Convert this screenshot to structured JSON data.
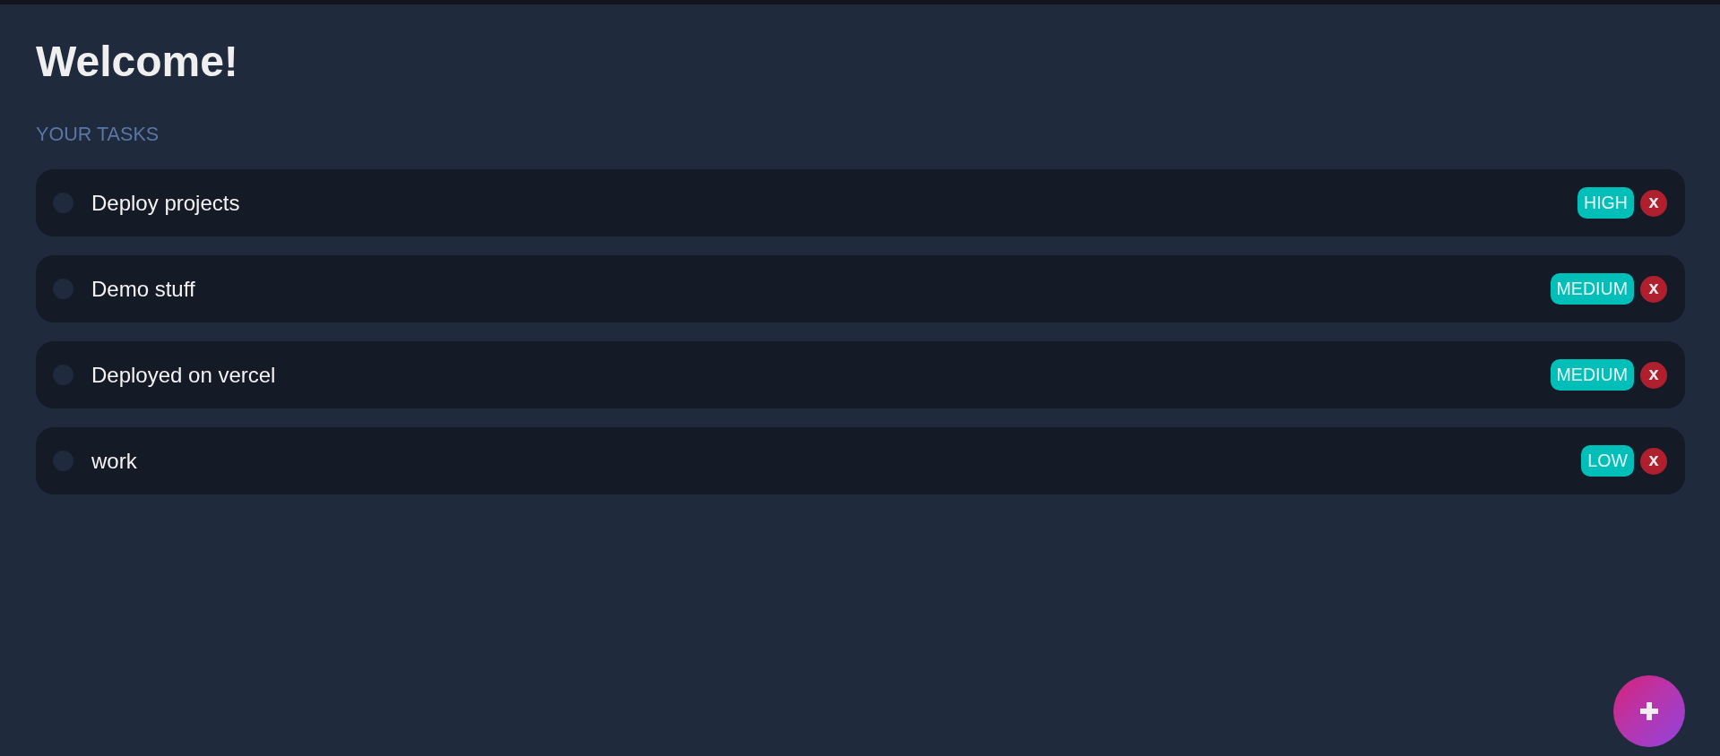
{
  "page": {
    "title": "Welcome!"
  },
  "tasks_section": {
    "heading": "YOUR TASKS",
    "tasks": [
      {
        "title": "Deploy projects",
        "checked": false,
        "priority": "HIGH",
        "delete_label": "x"
      },
      {
        "title": "Demo stuff",
        "checked": false,
        "priority": "MEDIUM",
        "delete_label": "x"
      },
      {
        "title": "Deployed on vercel",
        "checked": false,
        "priority": "MEDIUM",
        "delete_label": "x"
      },
      {
        "title": "work",
        "checked": false,
        "priority": "LOW",
        "delete_label": "x"
      }
    ]
  }
}
